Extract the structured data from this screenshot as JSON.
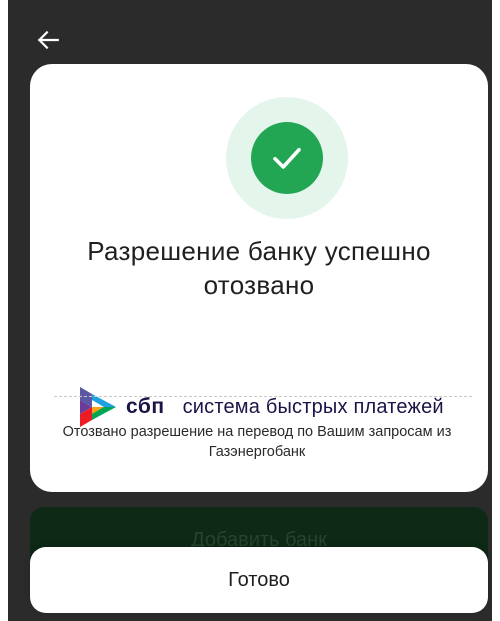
{
  "header": {
    "back_icon": "arrow-left-icon"
  },
  "dialog": {
    "status_icon": "checkmark-icon",
    "title": "Разрешение банку успешно отозвано",
    "logo": {
      "short": "сбп",
      "long": "система быстрых платежей"
    },
    "message": "Отозвано разрешение на перевод по Вашим запросам из Газэнергобанк"
  },
  "background_button": {
    "label": "Добавить банк"
  },
  "done_button": {
    "label": "Готово"
  },
  "colors": {
    "success_green": "#22a654",
    "success_bg": "#e4f5ec",
    "overlay": "#2b2b2b",
    "sbp_text": "#1d1346"
  }
}
